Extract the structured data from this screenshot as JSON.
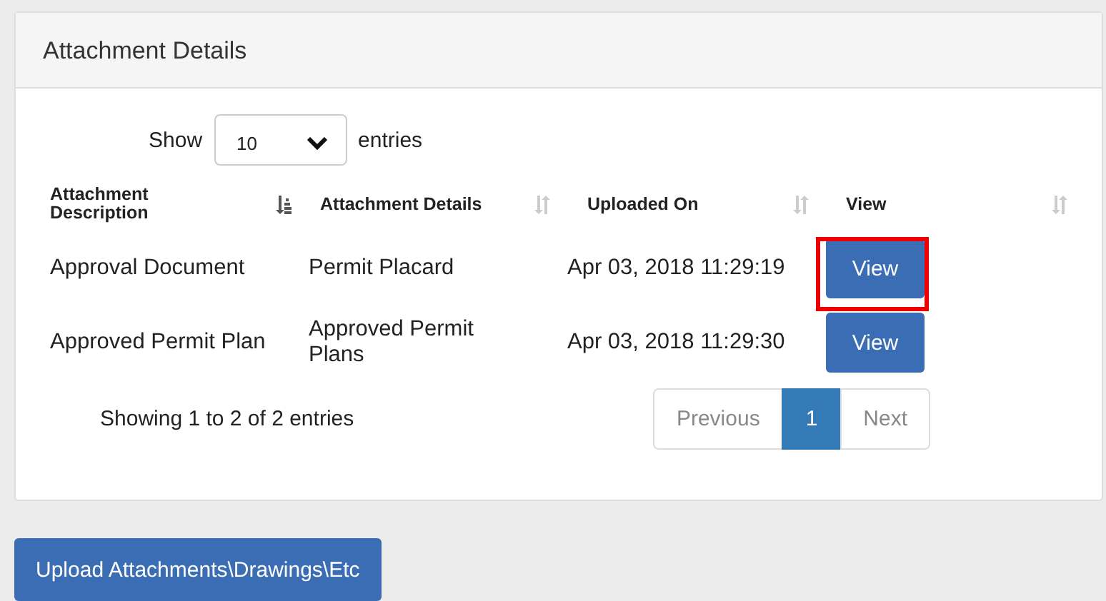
{
  "panel": {
    "title": "Attachment Details"
  },
  "length_menu": {
    "label_before": "Show",
    "value": "10",
    "label_after": "entries"
  },
  "table": {
    "columns": [
      {
        "label": "Attachment Description",
        "sorted": true
      },
      {
        "label": "Attachment Details",
        "sorted": false
      },
      {
        "label": "Uploaded On",
        "sorted": false
      },
      {
        "label": "View",
        "sorted": false
      }
    ],
    "rows": [
      {
        "description": "Approval Document",
        "details": "Permit Placard",
        "uploaded_on": "Apr 03, 2018 11:29:19",
        "button": "View",
        "highlighted": true
      },
      {
        "description": "Approved Permit Plan",
        "details": "Approved Permit Plans",
        "uploaded_on": "Apr 03, 2018 11:29:30",
        "button": "View",
        "highlighted": false
      }
    ]
  },
  "info": "Showing 1 to 2 of 2 entries",
  "pagination": [
    {
      "label": "Previous",
      "selected": false
    },
    {
      "label": "1",
      "selected": true
    },
    {
      "label": "Next",
      "selected": false
    }
  ],
  "upload_button": "Upload Attachments\\Drawings\\Etc"
}
